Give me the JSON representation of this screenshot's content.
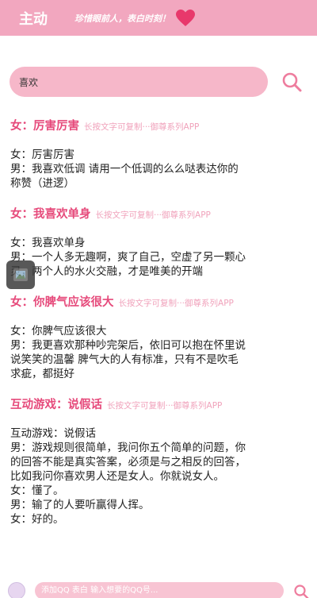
{
  "header": {
    "title": "主动",
    "slogan": "珍惜眼前人，表白时刻！"
  },
  "search": {
    "value": "喜欢"
  },
  "entries": [
    {
      "title": "女：厉害厉害",
      "hint": "长按文字可复制···御尊系列APP",
      "lines": [
        "女：厉害厉害",
        "男：我喜欢低调 请用一个低调的么么哒表达你的",
        "称赞（进逻）"
      ]
    },
    {
      "title": "女：我喜欢单身",
      "hint": "长按文字可复制···御尊系列APP",
      "lines": [
        "女：我喜欢单身",
        "男：一个人多无趣啊，爽了自己，空虚了另一颗心",
        "灵，两个人的水火交融，才是唯美的开端"
      ]
    },
    {
      "title": "女：你脾气应该很大",
      "hint": "长按文字可复制···御尊系列APP",
      "lines": [
        "女：你脾气应该很大",
        "男：我更喜欢那种吵完架后，依旧可以抱在怀里说",
        "说笑笑的温馨 脾气大的人有标准，只有不是吹毛",
        "求疵，都挺好"
      ]
    },
    {
      "title": "互动游戏：说假话",
      "hint": "长按文字可复制···御尊系列APP",
      "lines": [
        "互动游戏：说假话",
        "男：游戏规则很简单，我问你五个简单的问题，你",
        "的回答不能是真实答案，必须是与之相反的回答，",
        "比如我问你喜欢男人还是女人。你就说女人。",
        "女：懂了。",
        "男：输了的人要听赢得人挥。",
        "女：好的。"
      ]
    }
  ],
  "bottom": {
    "placeholder": "添加QQ 表白 输入想要的QQ号..."
  },
  "colors": {
    "header_bg": "#f2a7bf",
    "accent": "#e64a7b",
    "hint": "#f0a2bb",
    "search_bg": "#f6b7c9"
  },
  "icons": [
    "heart-icon",
    "search-icon",
    "floating-tool-icon",
    "avatar"
  ]
}
